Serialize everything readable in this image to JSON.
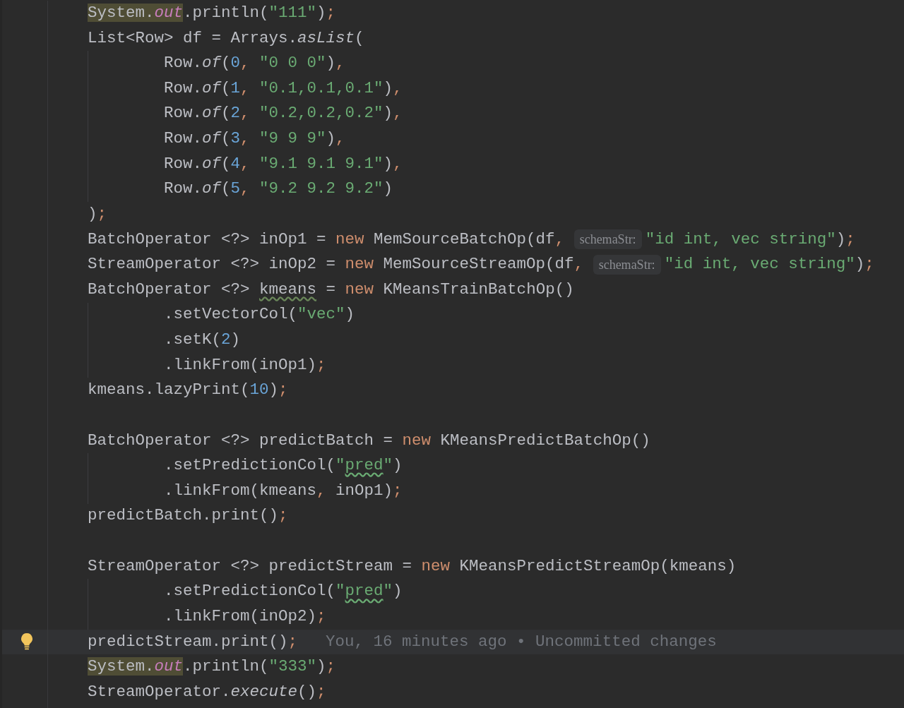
{
  "editor": {
    "lines": [
      {
        "current": false,
        "tokens": [
          {
            "kind": "hl",
            "text": "System."
          },
          {
            "kind": "hlfld",
            "text": "out"
          },
          {
            "kind": "t",
            "text": ".println("
          },
          {
            "kind": "str",
            "text": "\"111\""
          },
          {
            "kind": "t",
            "text": ")"
          },
          {
            "kind": "p",
            "text": ";"
          }
        ]
      },
      {
        "current": false,
        "tokens": [
          {
            "kind": "t",
            "text": "List<Row> df = Arrays."
          },
          {
            "kind": "it",
            "text": "asList"
          },
          {
            "kind": "t",
            "text": "("
          }
        ],
        "children": [
          {
            "current": false,
            "tokens": [
              {
                "kind": "t",
                "text": "Row."
              },
              {
                "kind": "it",
                "text": "of"
              },
              {
                "kind": "t",
                "text": "("
              },
              {
                "kind": "num",
                "text": "0"
              },
              {
                "kind": "p",
                "text": ", "
              },
              {
                "kind": "str",
                "text": "\"0 0 0\""
              },
              {
                "kind": "t",
                "text": ")"
              },
              {
                "kind": "p",
                "text": ","
              }
            ]
          },
          {
            "current": false,
            "tokens": [
              {
                "kind": "t",
                "text": "Row."
              },
              {
                "kind": "it",
                "text": "of"
              },
              {
                "kind": "t",
                "text": "("
              },
              {
                "kind": "num",
                "text": "1"
              },
              {
                "kind": "p",
                "text": ", "
              },
              {
                "kind": "str",
                "text": "\"0.1,0.1,0.1\""
              },
              {
                "kind": "t",
                "text": ")"
              },
              {
                "kind": "p",
                "text": ","
              }
            ]
          },
          {
            "current": false,
            "tokens": [
              {
                "kind": "t",
                "text": "Row."
              },
              {
                "kind": "it",
                "text": "of"
              },
              {
                "kind": "t",
                "text": "("
              },
              {
                "kind": "num",
                "text": "2"
              },
              {
                "kind": "p",
                "text": ", "
              },
              {
                "kind": "str",
                "text": "\"0.2,0.2,0.2\""
              },
              {
                "kind": "t",
                "text": ")"
              },
              {
                "kind": "p",
                "text": ","
              }
            ]
          },
          {
            "current": false,
            "tokens": [
              {
                "kind": "t",
                "text": "Row."
              },
              {
                "kind": "it",
                "text": "of"
              },
              {
                "kind": "t",
                "text": "("
              },
              {
                "kind": "num",
                "text": "3"
              },
              {
                "kind": "p",
                "text": ", "
              },
              {
                "kind": "str",
                "text": "\"9 9 9\""
              },
              {
                "kind": "t",
                "text": ")"
              },
              {
                "kind": "p",
                "text": ","
              }
            ]
          },
          {
            "current": false,
            "tokens": [
              {
                "kind": "t",
                "text": "Row."
              },
              {
                "kind": "it",
                "text": "of"
              },
              {
                "kind": "t",
                "text": "("
              },
              {
                "kind": "num",
                "text": "4"
              },
              {
                "kind": "p",
                "text": ", "
              },
              {
                "kind": "str",
                "text": "\"9.1 9.1 9.1\""
              },
              {
                "kind": "t",
                "text": ")"
              },
              {
                "kind": "p",
                "text": ","
              }
            ]
          },
          {
            "current": false,
            "tokens": [
              {
                "kind": "t",
                "text": "Row."
              },
              {
                "kind": "it",
                "text": "of"
              },
              {
                "kind": "t",
                "text": "("
              },
              {
                "kind": "num",
                "text": "5"
              },
              {
                "kind": "p",
                "text": ", "
              },
              {
                "kind": "str",
                "text": "\"9.2 9.2 9.2\""
              },
              {
                "kind": "t",
                "text": ")"
              }
            ]
          }
        ]
      },
      {
        "current": false,
        "tokens": [
          {
            "kind": "t",
            "text": ")"
          },
          {
            "kind": "p",
            "text": ";"
          }
        ]
      },
      {
        "current": false,
        "tokens": [
          {
            "kind": "t",
            "text": "BatchOperator <?> inOp1 = "
          },
          {
            "kind": "kw",
            "text": "new "
          },
          {
            "kind": "t",
            "text": "MemSourceBatchOp(df"
          },
          {
            "kind": "p",
            "text": ", "
          },
          {
            "kind": "hint",
            "text": "schemaStr:"
          },
          {
            "kind": "str",
            "text": "\"id int, vec string\""
          },
          {
            "kind": "t",
            "text": ")"
          },
          {
            "kind": "p",
            "text": ";"
          }
        ]
      },
      {
        "current": false,
        "tokens": [
          {
            "kind": "t",
            "text": "StreamOperator <?> inOp2 = "
          },
          {
            "kind": "kw",
            "text": "new "
          },
          {
            "kind": "t",
            "text": "MemSourceStreamOp(df"
          },
          {
            "kind": "p",
            "text": ", "
          },
          {
            "kind": "hint",
            "text": "schemaStr:"
          },
          {
            "kind": "str",
            "text": "\"id int, vec string\""
          },
          {
            "kind": "t",
            "text": ")"
          },
          {
            "kind": "p",
            "text": ";"
          }
        ]
      },
      {
        "current": false,
        "tokens": [
          {
            "kind": "t",
            "text": "BatchOperator <?> "
          },
          {
            "kind": "typo",
            "text": "kmeans"
          },
          {
            "kind": "t",
            "text": " = "
          },
          {
            "kind": "kw",
            "text": "new "
          },
          {
            "kind": "t",
            "text": "KMeansTrainBatchOp()"
          }
        ],
        "children": [
          {
            "current": false,
            "tokens": [
              {
                "kind": "t",
                "text": ".setVectorCol("
              },
              {
                "kind": "str",
                "text": "\"vec\""
              },
              {
                "kind": "t",
                "text": ")"
              }
            ]
          },
          {
            "current": false,
            "tokens": [
              {
                "kind": "t",
                "text": ".setK("
              },
              {
                "kind": "num",
                "text": "2"
              },
              {
                "kind": "t",
                "text": ")"
              }
            ]
          },
          {
            "current": false,
            "tokens": [
              {
                "kind": "t",
                "text": ".linkFrom(inOp1)"
              },
              {
                "kind": "p",
                "text": ";"
              }
            ]
          }
        ]
      },
      {
        "current": false,
        "tokens": [
          {
            "kind": "t",
            "text": "kmeans.lazyPrint("
          },
          {
            "kind": "num",
            "text": "10"
          },
          {
            "kind": "t",
            "text": ")"
          },
          {
            "kind": "p",
            "text": ";"
          }
        ]
      },
      {
        "current": false
      },
      {
        "current": false,
        "tokens": [
          {
            "kind": "t",
            "text": "BatchOperator <?> predictBatch = "
          },
          {
            "kind": "kw",
            "text": "new "
          },
          {
            "kind": "t",
            "text": "KMeansPredictBatchOp()"
          }
        ],
        "children": [
          {
            "current": false,
            "tokens": [
              {
                "kind": "t",
                "text": ".setPredictionCol("
              },
              {
                "kind": "str",
                "text": "\""
              },
              {
                "kind": "strtypo",
                "text": "pred"
              },
              {
                "kind": "str",
                "text": "\""
              },
              {
                "kind": "t",
                "text": ")"
              }
            ]
          },
          {
            "current": false,
            "tokens": [
              {
                "kind": "t",
                "text": ".linkFrom(kmeans"
              },
              {
                "kind": "p",
                "text": ", "
              },
              {
                "kind": "t",
                "text": "inOp1)"
              },
              {
                "kind": "p",
                "text": ";"
              }
            ]
          }
        ]
      },
      {
        "current": false,
        "tokens": [
          {
            "kind": "t",
            "text": "predictBatch.print()"
          },
          {
            "kind": "p",
            "text": ";"
          }
        ]
      },
      {
        "current": false
      },
      {
        "current": false,
        "tokens": [
          {
            "kind": "t",
            "text": "StreamOperator <?> predictStream = "
          },
          {
            "kind": "kw",
            "text": "new "
          },
          {
            "kind": "t",
            "text": "KMeansPredictStreamOp(kmeans)"
          }
        ],
        "children": [
          {
            "current": false,
            "tokens": [
              {
                "kind": "t",
                "text": ".setPredictionCol("
              },
              {
                "kind": "str",
                "text": "\""
              },
              {
                "kind": "strtypo",
                "text": "pred"
              },
              {
                "kind": "str",
                "text": "\""
              },
              {
                "kind": "t",
                "text": ")"
              }
            ]
          },
          {
            "current": false,
            "tokens": [
              {
                "kind": "t",
                "text": ".linkFrom(inOp2)"
              },
              {
                "kind": "p",
                "text": ";"
              }
            ]
          }
        ]
      },
      {
        "current": true,
        "tokens": [
          {
            "kind": "t",
            "text": "predictStream.print()"
          },
          {
            "kind": "p",
            "text": ";"
          },
          {
            "kind": "blame",
            "text": "You, 16 minutes ago • Uncommitted changes"
          }
        ]
      },
      {
        "current": false,
        "tokens": [
          {
            "kind": "hl",
            "text": "System."
          },
          {
            "kind": "hlfld",
            "text": "out"
          },
          {
            "kind": "t",
            "text": ".println("
          },
          {
            "kind": "str",
            "text": "\"333\""
          },
          {
            "kind": "t",
            "text": ")"
          },
          {
            "kind": "p",
            "text": ";"
          }
        ]
      },
      {
        "current": false,
        "tokens": [
          {
            "kind": "t",
            "text": "StreamOperator."
          },
          {
            "kind": "it",
            "text": "execute"
          },
          {
            "kind": "t",
            "text": "()"
          },
          {
            "kind": "p",
            "text": ";"
          }
        ]
      }
    ]
  }
}
